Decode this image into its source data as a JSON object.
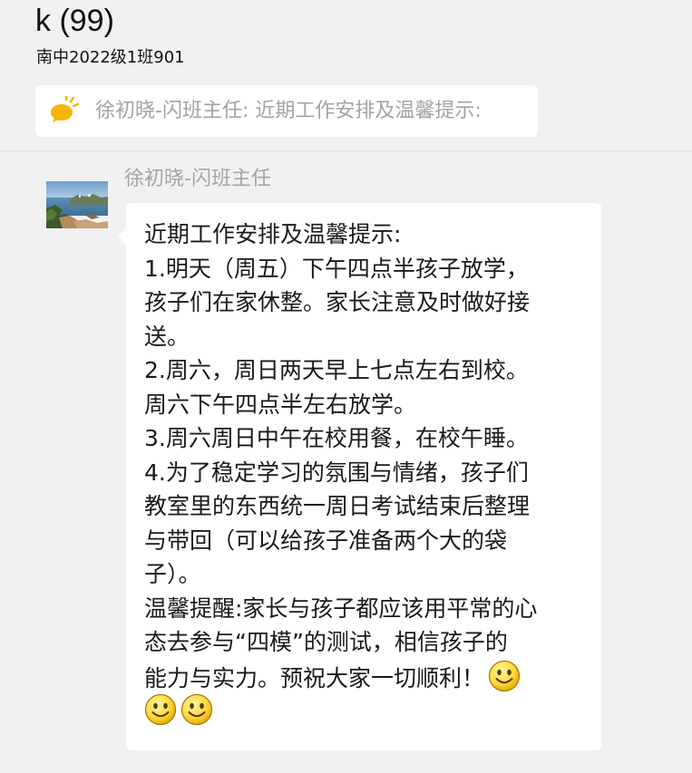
{
  "header": {
    "title": "k (99)",
    "subtitle": "南中2022级1班901"
  },
  "pinned": {
    "icon": "announcement-icon",
    "text": "徐初晓-闪班主任: 近期工作安排及温馨提示:"
  },
  "message": {
    "sender": "徐初晓-闪班主任",
    "avatar": "seaside-photo-avatar",
    "lines": [
      "近期工作安排及温馨提示:",
      "1.明天（周五）下午四点半孩子放学，",
      "孩子们在家休整。家长注意及时做好接",
      "送。",
      "2.周六，周日两天早上七点左右到校。",
      "周六下午四点半左右放学。",
      "3.周六周日中午在校用餐，在校午睡。",
      "4.为了稳定学习的氛围与情绪，孩子们",
      "教室里的东西统一周日考试结束后整理",
      "与带回（可以给孩子准备两个大的袋",
      "子）。",
      "温馨提醒:家长与孩子都应该用平常的心",
      "态去参与“四模”的测试，相信孩子的",
      "能力与实力。预祝大家一切顺利！"
    ],
    "emoji": "smile-emoji-icon"
  }
}
